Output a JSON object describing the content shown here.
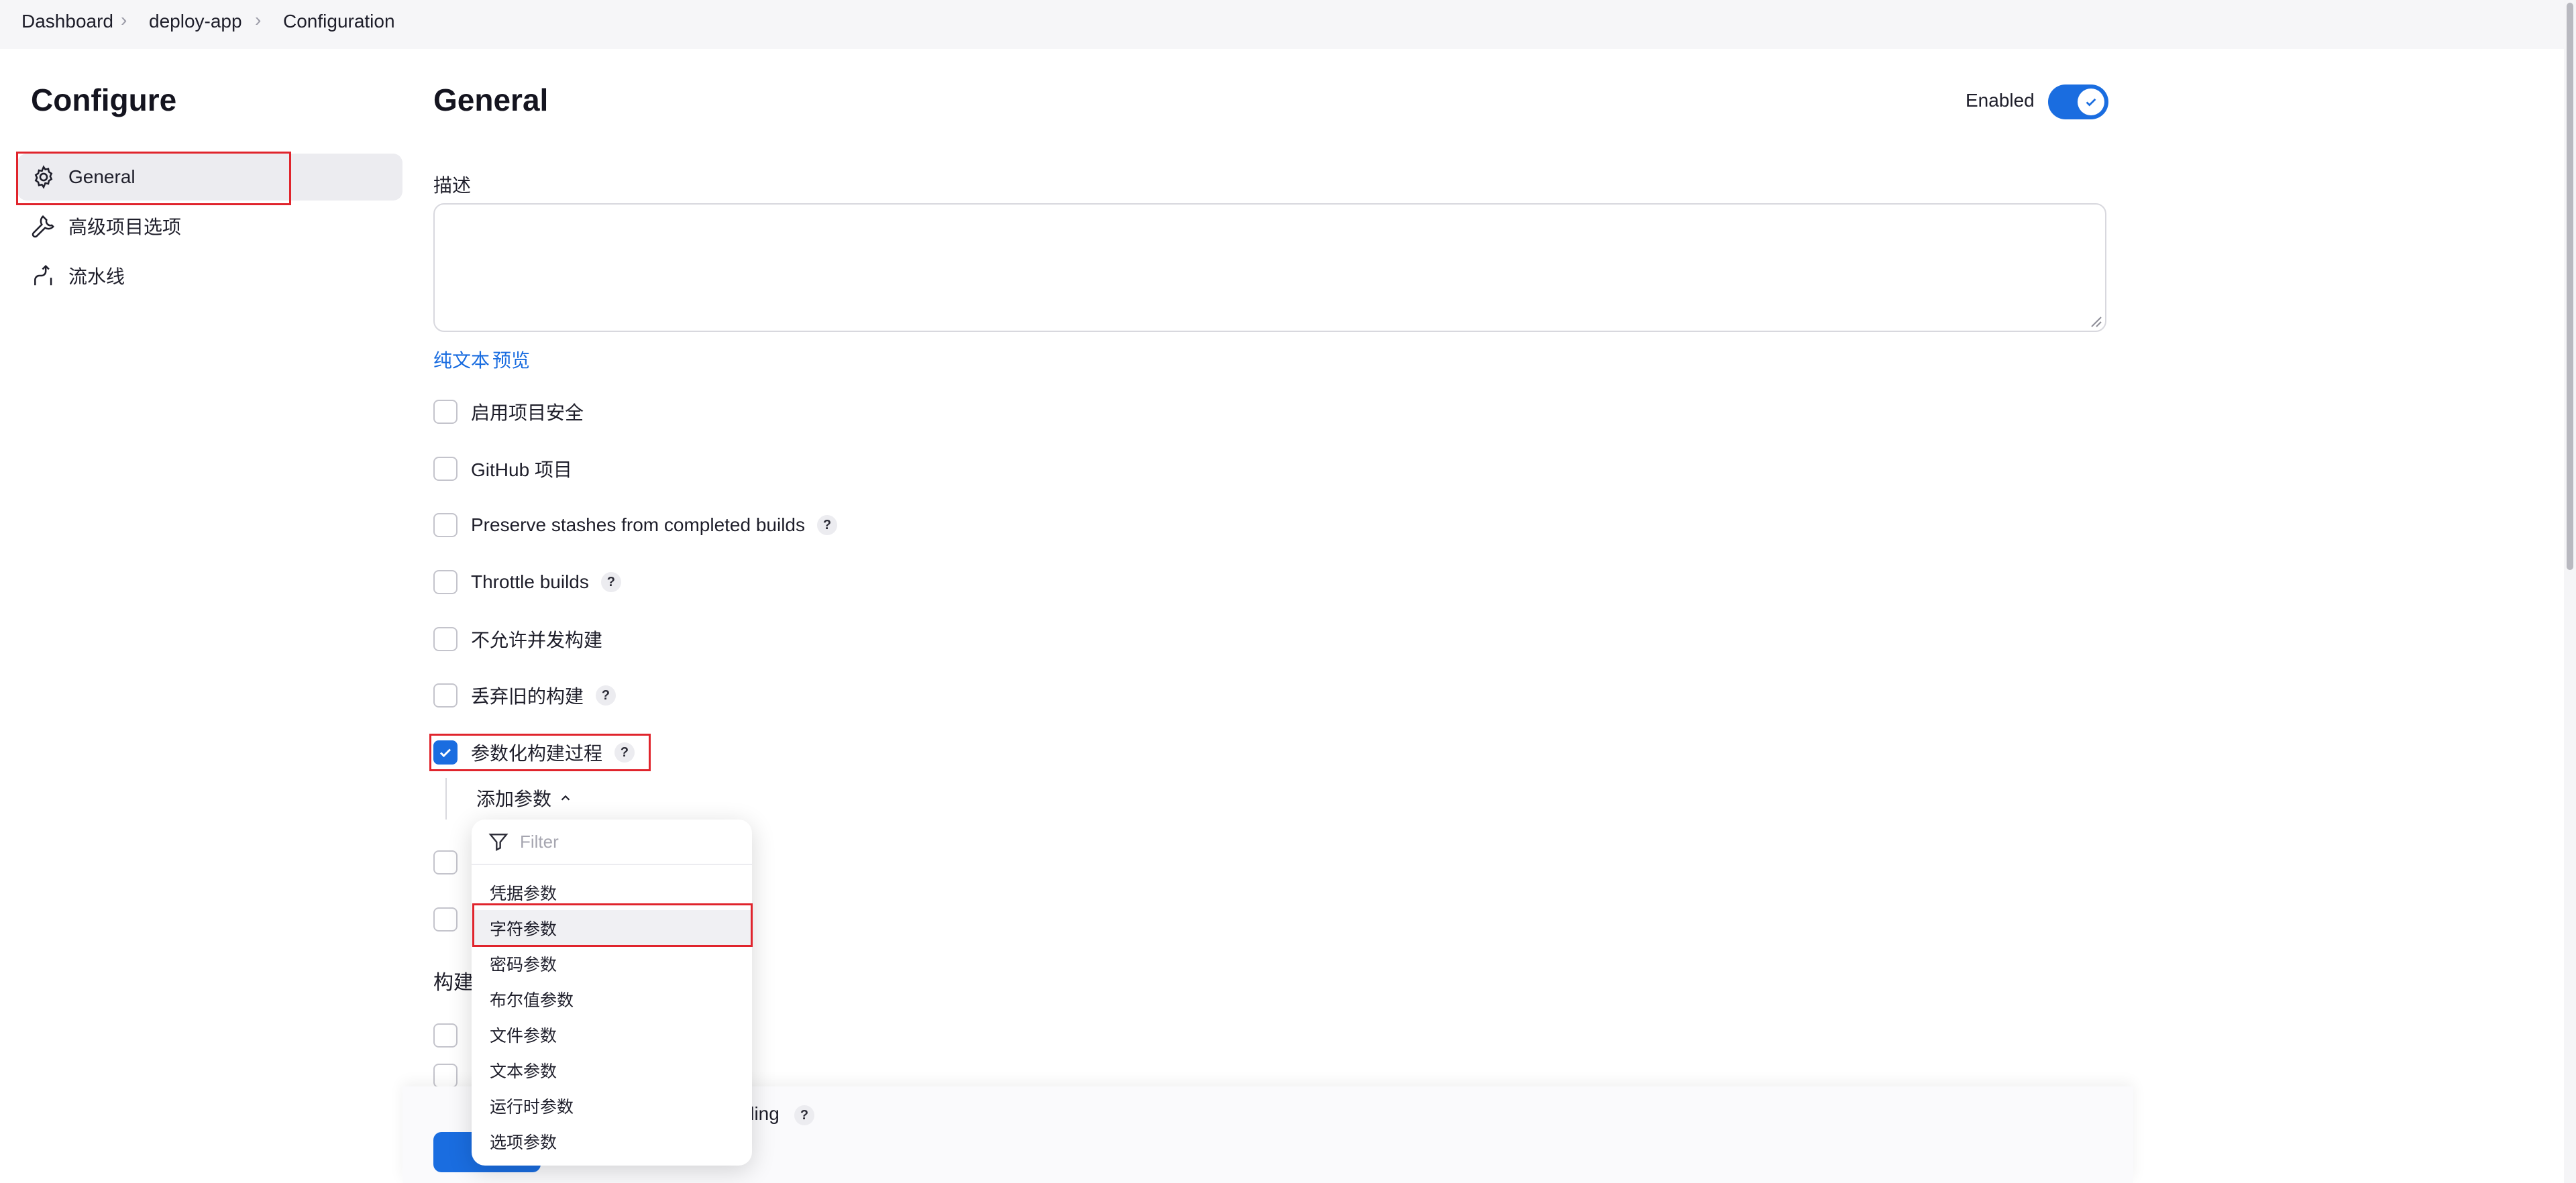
{
  "breadcrumb": {
    "items": [
      "Dashboard",
      "deploy-app",
      "Configuration"
    ]
  },
  "sidebar": {
    "title": "Configure",
    "items": [
      {
        "label": "General",
        "icon": "gear-icon"
      },
      {
        "label": "高级项目选项",
        "icon": "wrench-icon"
      },
      {
        "label": "流水线",
        "icon": "pipeline-icon"
      }
    ]
  },
  "main": {
    "title": "General",
    "enabled_label": "Enabled",
    "enabled": true,
    "description_label": "描述",
    "description_value": "",
    "links": {
      "plain_text": "纯文本",
      "preview": "预览"
    },
    "options": [
      {
        "label": "启用项目安全",
        "checked": false,
        "help": false
      },
      {
        "label": "GitHub 项目",
        "checked": false,
        "help": false
      },
      {
        "label": "Preserve stashes from completed builds",
        "checked": false,
        "help": true
      },
      {
        "label": "Throttle builds",
        "checked": false,
        "help": true
      },
      {
        "label": "不允许并发构建",
        "checked": false,
        "help": false
      },
      {
        "label": "丢弃旧的构建",
        "checked": false,
        "help": true
      },
      {
        "label": "参数化构建过程",
        "checked": true,
        "help": true
      }
    ],
    "help_glyph": "?",
    "add_param_label": "添加参数",
    "section_partial": "构建",
    "partial_bottom_text": "lling"
  },
  "dropdown": {
    "filter_placeholder": "Filter",
    "items": [
      "凭据参数",
      "字符参数",
      "密码参数",
      "布尔值参数",
      "文件参数",
      "文本参数",
      "运行时参数",
      "选项参数"
    ],
    "hovered": "字符参数"
  },
  "colors": {
    "accent": "#1a6de0",
    "annotation": "#e0242c"
  }
}
